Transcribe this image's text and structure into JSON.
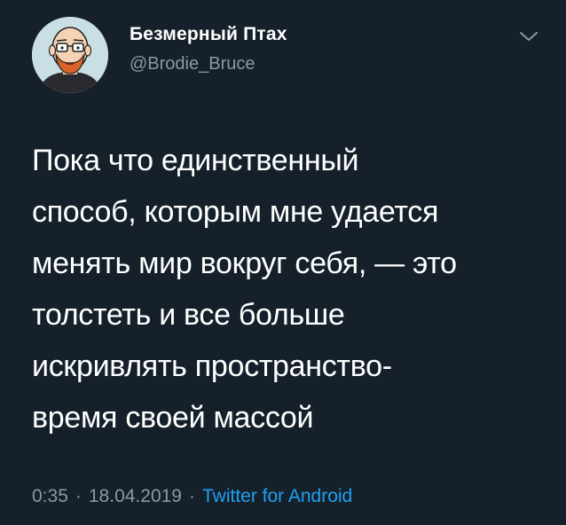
{
  "author": {
    "display_name": "Безмерный Птах",
    "handle": "@Brodie_Bruce",
    "avatar_icon": "cartoon-bald-man-with-glasses-avatar"
  },
  "tweet": {
    "lines": [
      "Пока что единственный",
      "способ, которым мне удается",
      "менять мир вокруг себя, — это",
      "толстеть и все больше",
      "искривлять пространство-",
      "время своей массой"
    ]
  },
  "meta": {
    "time": "0:35",
    "date": "18.04.2019",
    "separator": "·",
    "source": "Twitter for Android"
  },
  "icons": {
    "more": "chevron-down-icon"
  },
  "colors": {
    "background": "#15202b",
    "text": "#ffffff",
    "secondary": "#8899a6",
    "link": "#1da1f2"
  }
}
